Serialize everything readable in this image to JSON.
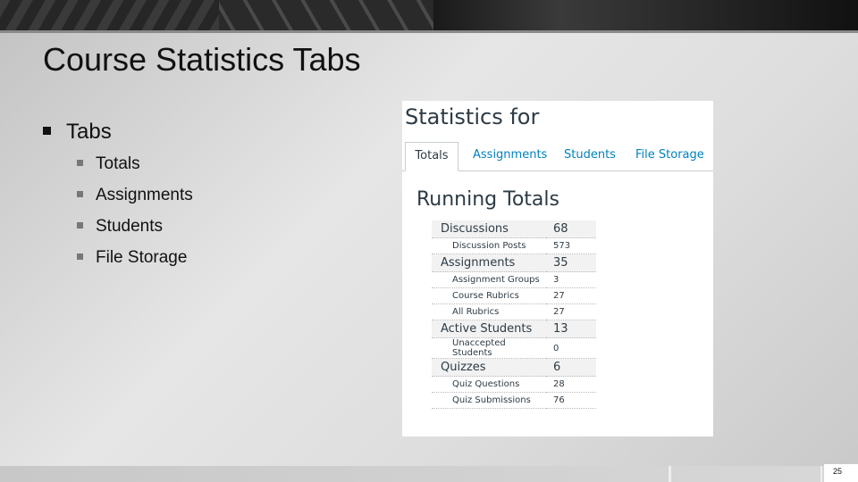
{
  "slide": {
    "title": "Course Statistics Tabs",
    "bullet": "Tabs",
    "sub_bullets": [
      "Totals",
      "Assignments",
      "Students",
      "File Storage"
    ],
    "page_number": "25"
  },
  "screenshot": {
    "heading": "Statistics for",
    "tabs": [
      {
        "label": "Totals",
        "active": true
      },
      {
        "label": "Assignments",
        "active": false
      },
      {
        "label": "Students",
        "active": false
      },
      {
        "label": "File Storage",
        "active": false
      }
    ],
    "section_title": "Running Totals",
    "rows": [
      {
        "label": "Discussions",
        "value": "68",
        "level": "major"
      },
      {
        "label": "Discussion Posts",
        "value": "573",
        "level": "minor"
      },
      {
        "label": "Assignments",
        "value": "35",
        "level": "major"
      },
      {
        "label": "Assignment Groups",
        "value": "3",
        "level": "minor"
      },
      {
        "label": "Course Rubrics",
        "value": "27",
        "level": "minor"
      },
      {
        "label": "All Rubrics",
        "value": "27",
        "level": "minor"
      },
      {
        "label": "Active Students",
        "value": "13",
        "level": "major"
      },
      {
        "label": "Unaccepted Students",
        "value": "0",
        "level": "minor"
      },
      {
        "label": "Quizzes",
        "value": "6",
        "level": "major"
      },
      {
        "label": "Quiz Questions",
        "value": "28",
        "level": "minor"
      },
      {
        "label": "Quiz Submissions",
        "value": "76",
        "level": "minor"
      }
    ]
  },
  "colors": {
    "link_blue": "#0081bd",
    "text_dark": "#2d3b45"
  }
}
